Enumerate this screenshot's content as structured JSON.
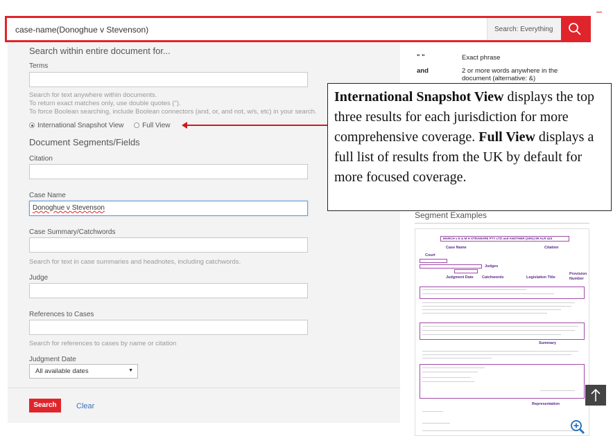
{
  "search": {
    "query": "case-name(Donoghue v Stevenson)",
    "scope_label": "Search: Everything"
  },
  "form": {
    "heading": "Search within entire document for...",
    "terms_label": "Terms",
    "terms_value": "",
    "hints": [
      "Search for text anywhere within documents.",
      "To return exact matches only, use double quotes (\").",
      "To force Boolean searching, include Boolean connectors (and, or, and not, w/s, etc) in your search."
    ],
    "view_options": [
      "International Snapshot View",
      "Full View"
    ],
    "selected_view": "International Snapshot View",
    "segments_heading": "Document Segments/Fields",
    "citation_label": "Citation",
    "citation_value": "",
    "case_name_label": "Case Name",
    "case_name_value": "Donoghue v Stevenson",
    "summary_label": "Case Summary/Catchwords",
    "summary_value": "",
    "summary_hint": "Search for text in case summaries and headnotes, including catchwords.",
    "judge_label": "Judge",
    "judge_value": "",
    "refs_label": "References to Cases",
    "refs_value": "",
    "refs_hint": "Search for references to cases by name or citation",
    "date_label": "Judgment Date",
    "date_value": "All available dates",
    "search_button": "Search",
    "clear_button": "Clear"
  },
  "help": {
    "rows": [
      {
        "symbol": "\" \"",
        "text": "Exact phrase"
      },
      {
        "symbol": "and",
        "text": "2 or more words anywhere in the document (alternative: &)"
      }
    ],
    "segment_examples_title": "Segment Examples",
    "segment_labels": {
      "case_name": "Case Name",
      "citation": "Citation",
      "court": "Court",
      "judges": "Judges",
      "judgment_date": "Judgment Date",
      "catchwords": "Catchwords",
      "legislation_title": "Legislation Title",
      "provision_number": "Provision Number",
      "summary": "Summary",
      "representation": "Representation"
    },
    "sample_title": "MARCH v E & M H STRAMARE PTY LTD and ANOTHER (1991) 99 ALR 423"
  },
  "callout": {
    "term1": "International Snapshot View",
    "text1": " displays the top three results for each jurisdiction for more comprehensive coverage. ",
    "term2": "Full View",
    "text2": " displays a full list of results from the UK by default for more focused coverage."
  },
  "colors": {
    "brand_red": "#e0242b",
    "link_blue": "#3a72b8",
    "annotation_purple": "#5b2a8a"
  }
}
